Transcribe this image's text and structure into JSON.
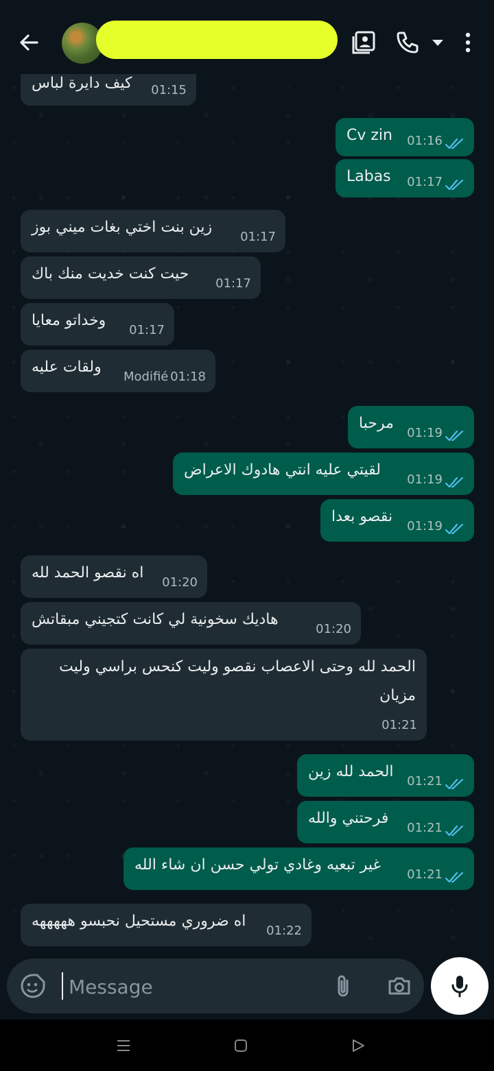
{
  "composer": {
    "placeholder": "Message"
  },
  "messages": [
    {
      "dir": "in",
      "text": "كيف دايرة لباس",
      "time": "01:15"
    },
    {
      "dir": "out",
      "text": "Cv zin",
      "time": "01:16"
    },
    {
      "dir": "out",
      "text": "Labas",
      "time": "01:17"
    },
    {
      "dir": "in",
      "text": "زين بنت اختي بغات ميني بوز",
      "time": "01:17"
    },
    {
      "dir": "in",
      "text": "حيت كنت خديت منك باك",
      "time": "01:17"
    },
    {
      "dir": "in",
      "text": "وخداتو معايا",
      "time": "01:17"
    },
    {
      "dir": "in",
      "text": "ولقات عليه",
      "time": "01:18",
      "edited": "Modifié"
    },
    {
      "dir": "out",
      "text": "مرحبا",
      "time": "01:19"
    },
    {
      "dir": "out",
      "text": "لقيتي عليه انتي هادوك الاعراض",
      "time": "01:19"
    },
    {
      "dir": "out",
      "text": "نقصو بعدا",
      "time": "01:19"
    },
    {
      "dir": "in",
      "text": "اه نقصو الحمد لله",
      "time": "01:20"
    },
    {
      "dir": "in",
      "text": "هاديك سخونية لي كانت كتجيني مبقاتش",
      "time": "01:20"
    },
    {
      "dir": "in",
      "text": "الحمد لله وحتى الاعصاب نقصو وليت كنحس براسي وليت مزيان",
      "time": "01:21"
    },
    {
      "dir": "out",
      "text": "الحمد لله زين",
      "time": "01:21"
    },
    {
      "dir": "out",
      "text": "فرحتني والله",
      "time": "01:21"
    },
    {
      "dir": "out",
      "text": "غير تبعيه وغادي تولي حسن ان شاء الله",
      "time": "01:21"
    },
    {
      "dir": "in",
      "text": "اه ضروري مستحيل نحبسو هههههه",
      "time": "01:22"
    }
  ],
  "colors": {
    "background": "#0b141a",
    "incoming_bubble": "#202c33",
    "outgoing_bubble": "#005c4b",
    "read_ticks": "#53bdeb",
    "name_highlight": "#e5ff2a"
  }
}
